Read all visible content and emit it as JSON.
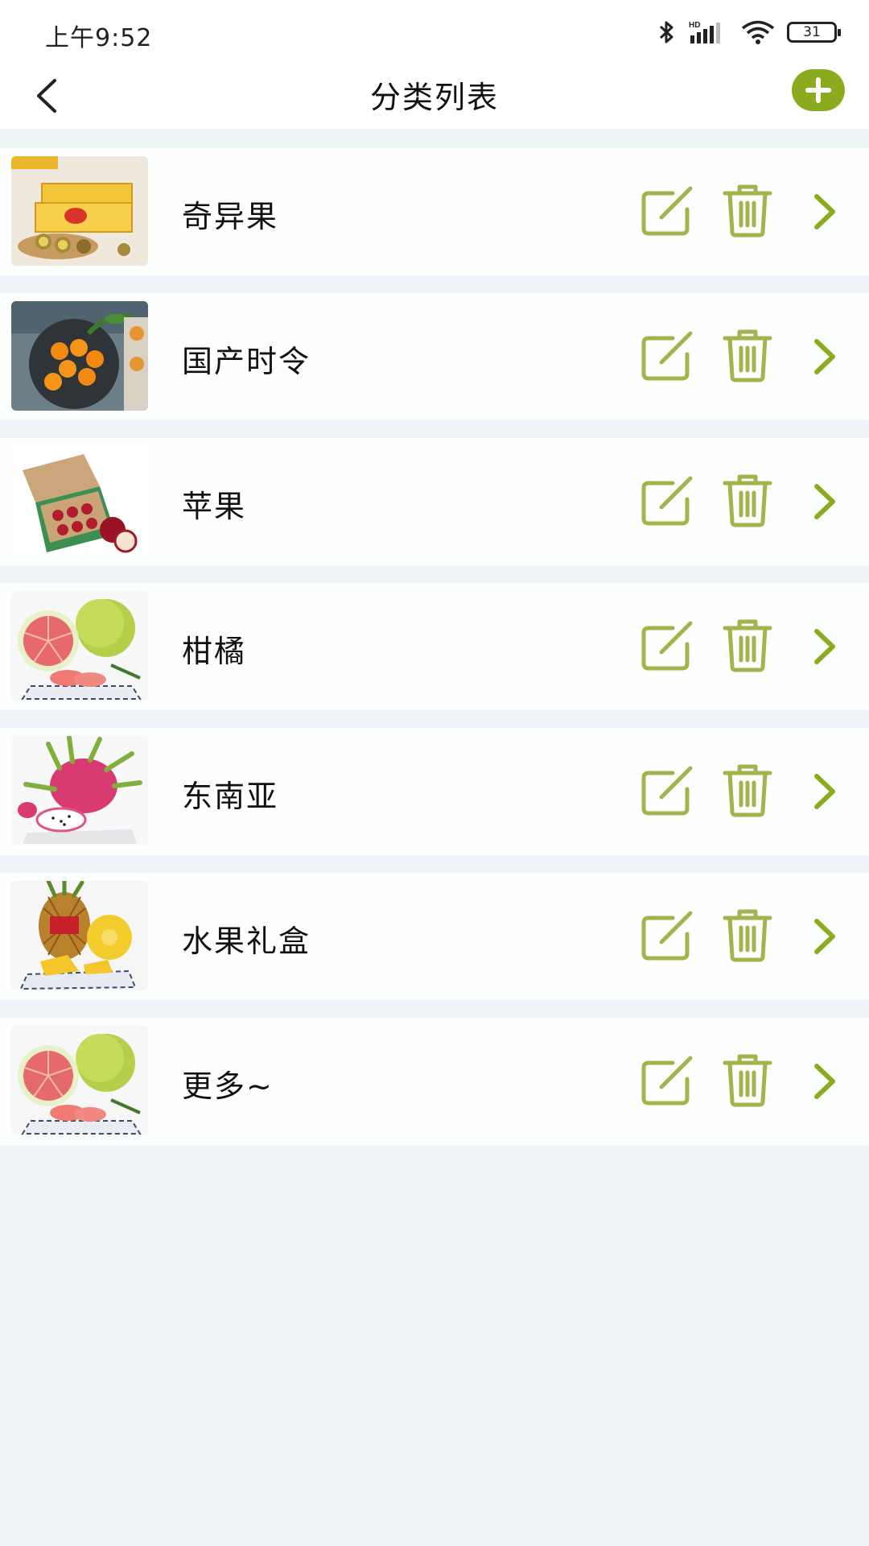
{
  "status_bar": {
    "time": "上午9:52",
    "battery": "31",
    "icons": [
      "bluetooth-icon",
      "hd-signal-icon",
      "wifi-icon",
      "battery-icon"
    ]
  },
  "header": {
    "title": "分类列表",
    "back_icon": "chevron-left-icon",
    "add_icon": "plus-icon"
  },
  "colors": {
    "accent": "#8aac1f",
    "background": "#eef4f7",
    "row": "#fdfefe"
  },
  "categories": [
    {
      "label": "奇异果",
      "thumbnail": "kiwi-box-image"
    },
    {
      "label": "国产时令",
      "thumbnail": "tangerine-bowl-image"
    },
    {
      "label": "苹果",
      "thumbnail": "apple-box-image"
    },
    {
      "label": "柑橘",
      "thumbnail": "pomelo-image"
    },
    {
      "label": "东南亚",
      "thumbnail": "dragonfruit-image"
    },
    {
      "label": "水果礼盒",
      "thumbnail": "pineapple-image"
    },
    {
      "label": "更多~",
      "thumbnail": "pomelo-image"
    }
  ],
  "row_actions": [
    "edit-icon",
    "trash-icon",
    "chevron-right-icon"
  ]
}
